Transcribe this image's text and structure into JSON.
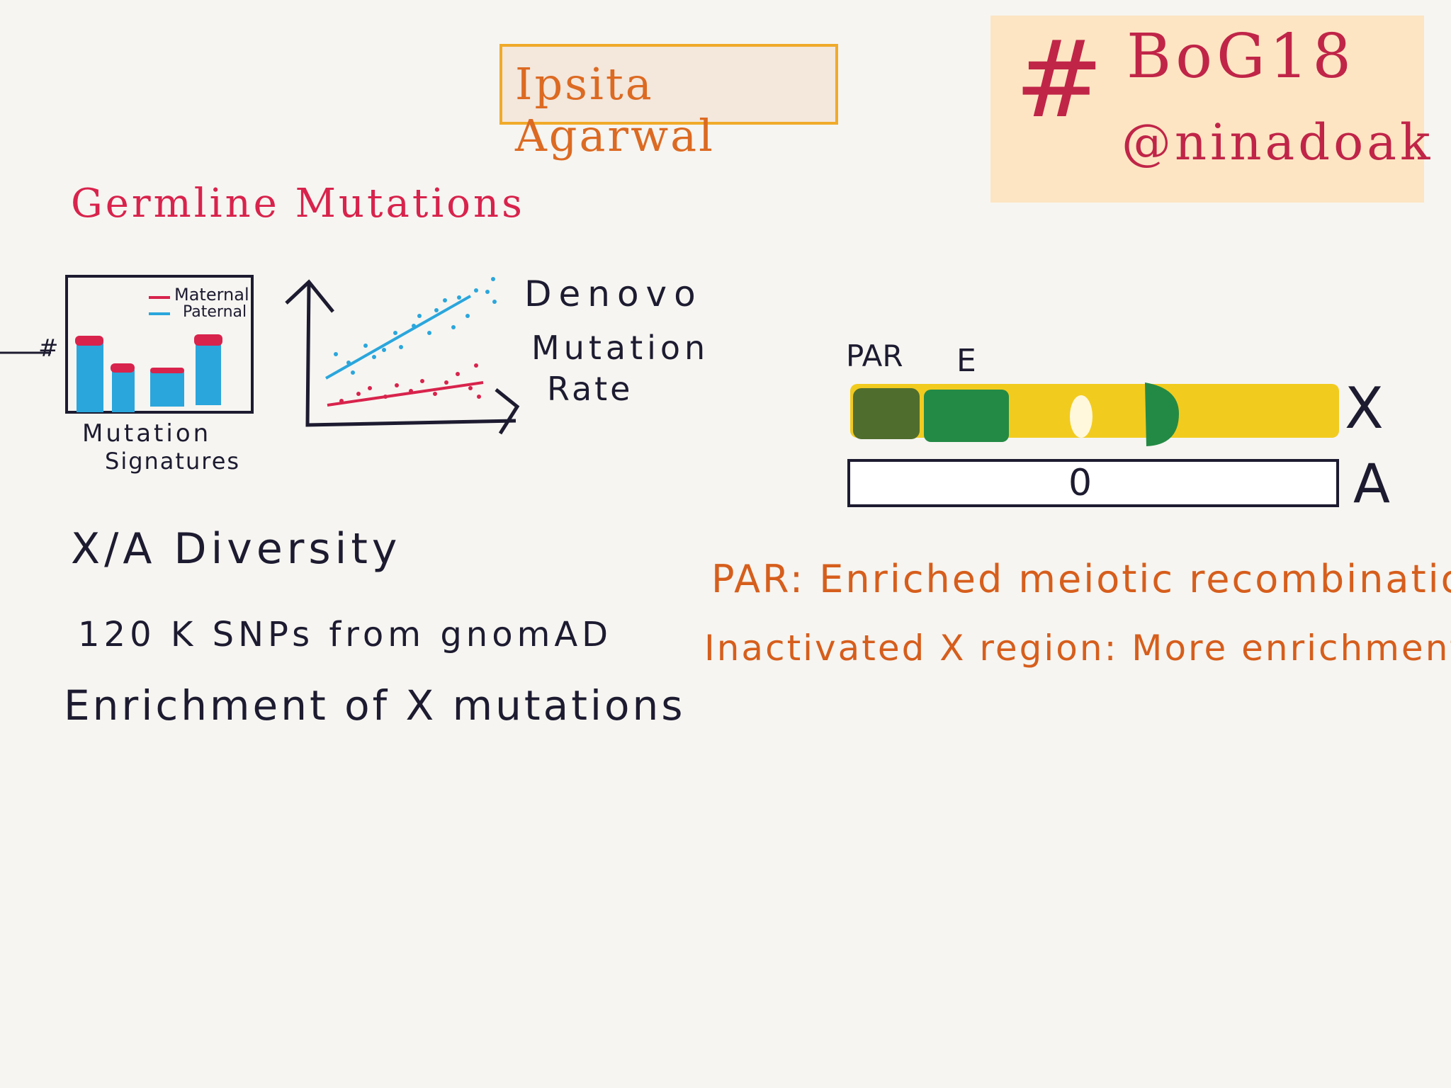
{
  "speaker": "Ipsita Agarwal",
  "event": {
    "hashtag_symbol": "#",
    "tag": "BoG18",
    "handle": "@ninadoak"
  },
  "section_heading": "Germline Mutations",
  "mutation_signatures": {
    "legend": [
      "Maternal",
      "Paternal"
    ],
    "y_label": "#",
    "caption_line1": "Mutation",
    "caption_line2": "Signatures"
  },
  "denovo": {
    "line1": "Denovo",
    "line2": "Mutation",
    "line3": "Rate"
  },
  "chromosome": {
    "par_label": "PAR",
    "e_label": "E",
    "x_label": "X",
    "a_label": "A",
    "a_marker": "0"
  },
  "notes": [
    "X/A Diversity",
    "120 K SNPs from gnomAD",
    "Enrichment of X mutations"
  ],
  "findings": [
    "PAR: Enriched meiotic recombination",
    "Inactivated X region: More enrichment"
  ],
  "colors": {
    "maternal": "#d8234c",
    "paternal": "#2aa6dc",
    "chromosome_x": "#f2cb1f",
    "par_region": "#4f6e2e",
    "escape_region": "#238a45"
  }
}
